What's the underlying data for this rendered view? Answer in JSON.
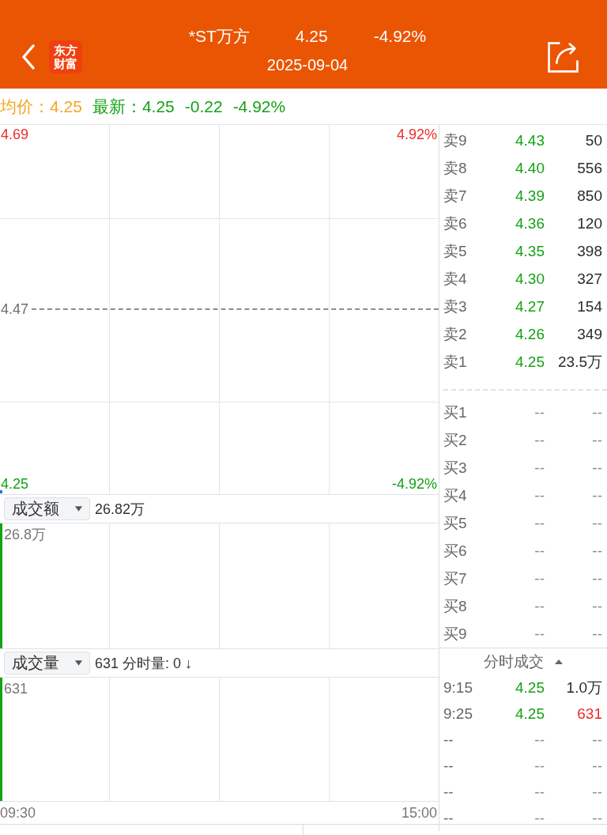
{
  "header": {
    "logo": "东方财富",
    "title": "*ST万方",
    "price": "4.25",
    "change": "-4.92%",
    "date": "2025-09-04"
  },
  "summary": {
    "average": {
      "text": "均价：4.25",
      "color": "#f5a623"
    },
    "latest": {
      "text": "最新：4.25",
      "color": "#13a213"
    },
    "change": {
      "text": "-0.22",
      "color": "#13a213"
    },
    "change_pct": {
      "text": "-4.92%",
      "color": "#13a213"
    }
  },
  "price_chart": {
    "top_left": {
      "text": "4.69",
      "color": "#ee2b2b"
    },
    "top_right": {
      "text": "4.92%",
      "color": "#ee2b2b"
    },
    "middle_left": {
      "text": "4.47",
      "color": "#6e6e6e"
    },
    "bottom_left": {
      "text": "4.25",
      "color": "#13a213"
    },
    "bottom_right": {
      "text": "-4.92%",
      "color": "#13a213"
    }
  },
  "amount_panel": {
    "selector": "成交额",
    "value": "26.82万",
    "axis_max": "26.8万",
    "bar": {
      "color": "#13a213"
    }
  },
  "volume_panel": {
    "selector": "成交量",
    "value": "631 分时量: 0 ↓",
    "axis_max": "631",
    "bar": {
      "color": "#13a213"
    }
  },
  "time_axis": {
    "start": "09:30",
    "end": "15:00"
  },
  "order_book": {
    "asks": [
      {
        "label": "卖9",
        "price": {
          "text": "4.43",
          "color": "#13a213"
        },
        "volume": {
          "text": "50",
          "color": "#2b2b2b"
        }
      },
      {
        "label": "卖8",
        "price": {
          "text": "4.40",
          "color": "#13a213"
        },
        "volume": {
          "text": "556",
          "color": "#2b2b2b"
        }
      },
      {
        "label": "卖7",
        "price": {
          "text": "4.39",
          "color": "#13a213"
        },
        "volume": {
          "text": "850",
          "color": "#2b2b2b"
        }
      },
      {
        "label": "卖6",
        "price": {
          "text": "4.36",
          "color": "#13a213"
        },
        "volume": {
          "text": "120",
          "color": "#2b2b2b"
        }
      },
      {
        "label": "卖5",
        "price": {
          "text": "4.35",
          "color": "#13a213"
        },
        "volume": {
          "text": "398",
          "color": "#2b2b2b"
        }
      },
      {
        "label": "卖4",
        "price": {
          "text": "4.30",
          "color": "#13a213"
        },
        "volume": {
          "text": "327",
          "color": "#2b2b2b"
        }
      },
      {
        "label": "卖3",
        "price": {
          "text": "4.27",
          "color": "#13a213"
        },
        "volume": {
          "text": "154",
          "color": "#2b2b2b"
        }
      },
      {
        "label": "卖2",
        "price": {
          "text": "4.26",
          "color": "#13a213"
        },
        "volume": {
          "text": "349",
          "color": "#2b2b2b"
        }
      },
      {
        "label": "卖1",
        "price": {
          "text": "4.25",
          "color": "#13a213"
        },
        "volume": {
          "text": "23.5万",
          "color": "#2b2b2b"
        }
      }
    ],
    "bids": [
      {
        "label": "买1",
        "price": {
          "text": "--",
          "color": "#8a8a8a"
        },
        "volume": {
          "text": "--",
          "color": "#8a8a8a"
        }
      },
      {
        "label": "买2",
        "price": {
          "text": "--",
          "color": "#8a8a8a"
        },
        "volume": {
          "text": "--",
          "color": "#8a8a8a"
        }
      },
      {
        "label": "买3",
        "price": {
          "text": "--",
          "color": "#8a8a8a"
        },
        "volume": {
          "text": "--",
          "color": "#8a8a8a"
        }
      },
      {
        "label": "买4",
        "price": {
          "text": "--",
          "color": "#8a8a8a"
        },
        "volume": {
          "text": "--",
          "color": "#8a8a8a"
        }
      },
      {
        "label": "买5",
        "price": {
          "text": "--",
          "color": "#8a8a8a"
        },
        "volume": {
          "text": "--",
          "color": "#8a8a8a"
        }
      },
      {
        "label": "买6",
        "price": {
          "text": "--",
          "color": "#8a8a8a"
        },
        "volume": {
          "text": "--",
          "color": "#8a8a8a"
        }
      },
      {
        "label": "买7",
        "price": {
          "text": "--",
          "color": "#8a8a8a"
        },
        "volume": {
          "text": "--",
          "color": "#8a8a8a"
        }
      },
      {
        "label": "买8",
        "price": {
          "text": "--",
          "color": "#8a8a8a"
        },
        "volume": {
          "text": "--",
          "color": "#8a8a8a"
        }
      },
      {
        "label": "买9",
        "price": {
          "text": "--",
          "color": "#8a8a8a"
        },
        "volume": {
          "text": "--",
          "color": "#8a8a8a"
        }
      }
    ]
  },
  "trades": {
    "title": "分时成交",
    "rows": [
      {
        "time": "9:15",
        "price": {
          "text": "4.25",
          "color": "#13a213"
        },
        "volume": {
          "text": "1.0万",
          "color": "#2b2b2b"
        }
      },
      {
        "time": "9:25",
        "price": {
          "text": "4.25",
          "color": "#13a213"
        },
        "volume": {
          "text": "631",
          "color": "#ee2b2b"
        }
      },
      {
        "time": "--",
        "price": {
          "text": "--",
          "color": "#8a8a8a"
        },
        "volume": {
          "text": "--",
          "color": "#8a8a8a"
        }
      },
      {
        "time": "--",
        "price": {
          "text": "--",
          "color": "#8a8a8a"
        },
        "volume": {
          "text": "--",
          "color": "#8a8a8a"
        }
      },
      {
        "time": "--",
        "price": {
          "text": "--",
          "color": "#8a8a8a"
        },
        "volume": {
          "text": "--",
          "color": "#8a8a8a"
        }
      },
      {
        "time": "--",
        "price": {
          "text": "--",
          "color": "#8a8a8a"
        },
        "volume": {
          "text": "--",
          "color": "#8a8a8a"
        }
      }
    ]
  }
}
